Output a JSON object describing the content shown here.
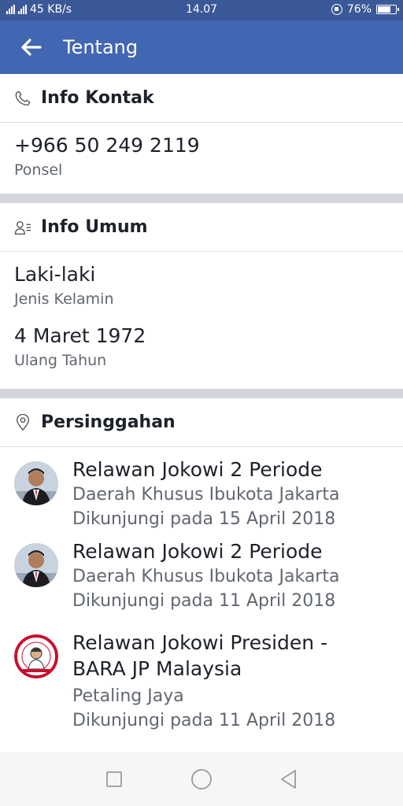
{
  "status_bar": {
    "network_speed": "45 KB/s",
    "time": "14.07",
    "battery": "76%",
    "battery_level": 0.76
  },
  "app_bar": {
    "title": "Tentang"
  },
  "contact": {
    "header": "Info Kontak",
    "phone": "+966 50 249 2119",
    "phone_label": "Ponsel"
  },
  "general": {
    "header": "Info Umum",
    "gender": "Laki-laki",
    "gender_label": "Jenis Kelamin",
    "birthday": "4 Maret 1972",
    "birthday_label": "Ulang Tahun"
  },
  "places": {
    "header": "Persinggahan",
    "items": [
      {
        "name": "Relawan Jokowi 2 Periode",
        "location": "Daerah Khusus Ibukota Jakarta",
        "visited": "Dikunjungi pada 15 April 2018"
      },
      {
        "name": "Relawan Jokowi 2 Periode",
        "location": "Daerah Khusus Ibukota Jakarta",
        "visited": "Dikunjungi pada 11 April 2018"
      },
      {
        "name_line1": "Relawan Jokowi Presiden -",
        "name_line2": "BARA JP Malaysia",
        "location": "Petaling Jaya",
        "visited": "Dikunjungi pada 11 April 2018"
      }
    ]
  },
  "colors": {
    "status_bar": "#3b5998",
    "app_bar": "#4267b2",
    "divider": "#d3d6db"
  }
}
